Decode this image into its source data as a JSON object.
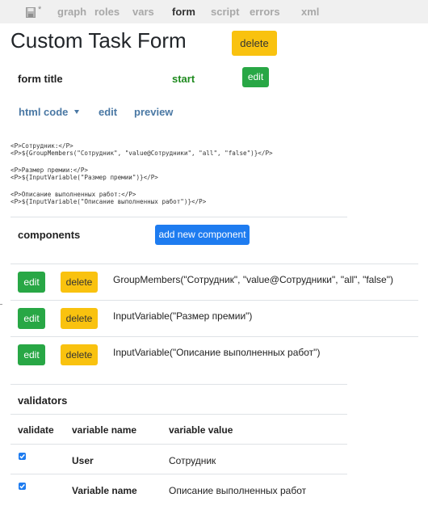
{
  "nav": {
    "save_marker": "*",
    "tabs": [
      "graph",
      "roles",
      "vars",
      "form",
      "script",
      "errors",
      "xml"
    ],
    "active_tab": "form"
  },
  "header": {
    "title": "Custom Task Form",
    "delete_label": "delete"
  },
  "form_title": {
    "label": "form title",
    "value": "start",
    "edit_label": "edit"
  },
  "code_view": {
    "mode_label": "html code",
    "edit_label": "edit",
    "preview_label": "preview",
    "lines": [
      "<P>Сотрудник:</P>",
      "<P>${GroupMembers(\"Сотрудник\", \"value@Сотрудники\", \"all\", \"false\")}</P>",
      "<P>Размер премии:</P>",
      "<P>${InputVariable(\"Размер премии\")}</P>",
      "<P>Описание выполненных работ:</P>",
      "<P>${InputVariable(\"Описание выполненных работ\")}</P>"
    ]
  },
  "components": {
    "heading": "components",
    "add_label": "add new component",
    "edit_label": "edit",
    "delete_label": "delete",
    "items": [
      "GroupMembers(\"Сотрудник\", \"value@Сотрудники\", \"all\", \"false\")",
      "InputVariable(\"Размер премии\")",
      "InputVariable(\"Описание выполненных работ\")"
    ]
  },
  "validators": {
    "heading": "validators",
    "columns": [
      "validate",
      "variable name",
      "variable value"
    ],
    "rows": [
      {
        "checked": true,
        "name": "User",
        "value": "Сотрудник"
      },
      {
        "checked": true,
        "name": "Variable name",
        "value": "Описание выполненных работ"
      }
    ]
  },
  "colors": {
    "yellow": "#f9c20f",
    "green": "#28a745",
    "blue": "#1e7cf0",
    "link": "#4a78a4"
  }
}
